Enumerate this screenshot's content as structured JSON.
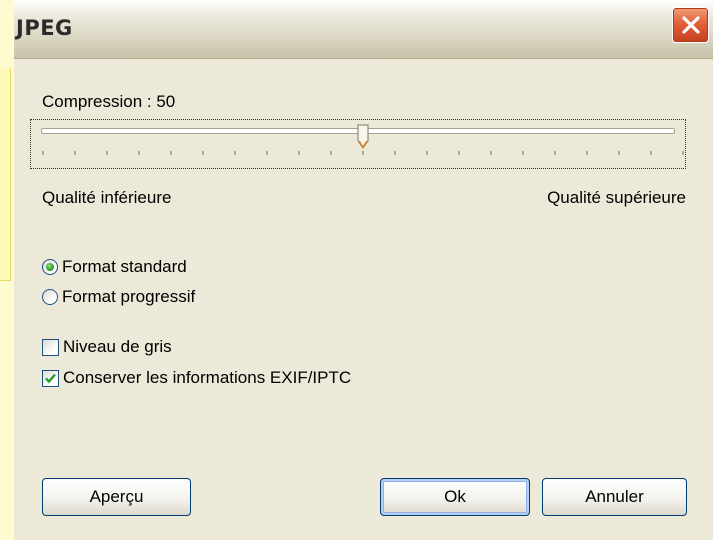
{
  "window": {
    "title": "JPEG",
    "close_icon": "close-x-icon"
  },
  "compression": {
    "label": "Compression : 50",
    "value": 50,
    "min": 0,
    "max": 100,
    "low_label": "Qualité inférieure",
    "high_label": "Qualité supérieure"
  },
  "format": {
    "options": [
      "Format standard",
      "Format progressif"
    ],
    "selected": "Format standard"
  },
  "checkboxes": {
    "grayscale": {
      "label": "Niveau de gris",
      "checked": false
    },
    "exif": {
      "label": "Conserver les informations EXIF/IPTC",
      "checked": true
    }
  },
  "buttons": {
    "preview": "Aperçu",
    "ok": "Ok",
    "cancel": "Annuler"
  },
  "colors": {
    "dialog_bg": "#ece9d8",
    "close_red": "#e2603a",
    "check_green": "#21a121",
    "button_border": "#003c74"
  }
}
